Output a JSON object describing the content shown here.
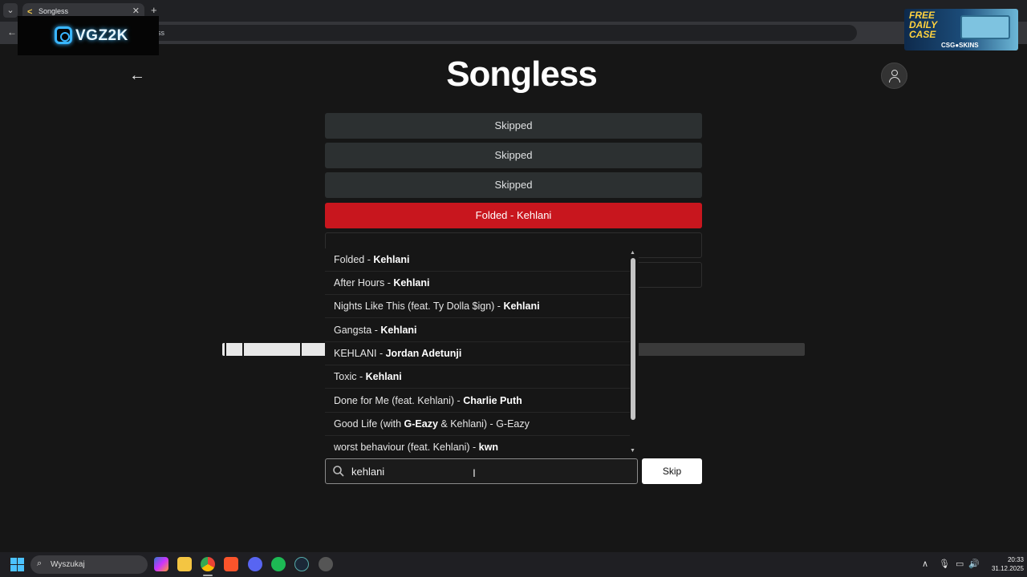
{
  "browser": {
    "tab_title": "Songless",
    "tab_favicon": "<",
    "url_fragment": "ss"
  },
  "overlay": {
    "streamer_name": "VGZ2K",
    "ad_headline": "FREE DAILY CASE",
    "ad_brand": "CSG●SKINS"
  },
  "page": {
    "logo": "Songless",
    "guesses": [
      {
        "label": "Skipped",
        "status": "skipped"
      },
      {
        "label": "Skipped",
        "status": "skipped"
      },
      {
        "label": "Skipped",
        "status": "skipped"
      },
      {
        "label": "Folded - Kehlani",
        "status": "answer"
      }
    ],
    "progress_fraction": 0.18
  },
  "dropdown": {
    "items": [
      {
        "title": "Folded",
        "sep": " - ",
        "artist": "Kehlani"
      },
      {
        "title": "After Hours",
        "sep": " - ",
        "artist": "Kehlani"
      },
      {
        "title": "Nights Like This (feat. Ty Dolla $ign)",
        "sep": " - ",
        "artist": "Kehlani"
      },
      {
        "title": "Gangsta",
        "sep": " - ",
        "artist": "Kehlani"
      },
      {
        "title": "KEHLANI",
        "sep": " - ",
        "artist": "Jordan Adetunji"
      },
      {
        "title": "Toxic",
        "sep": " - ",
        "artist": "Kehlani"
      },
      {
        "title": "Done for Me (feat. Kehlani)",
        "sep": " - ",
        "artist": "Charlie Puth"
      },
      {
        "title_pre": "Good Life (with ",
        "title_bold": "G-Eazy",
        "title_post": " & Kehlani) - G-Eazy"
      },
      {
        "title": "worst behaviour (feat. Kehlani)",
        "sep": " - ",
        "artist": "kwn"
      }
    ]
  },
  "search": {
    "value": "kehlani",
    "skip_label": "Skip"
  },
  "taskbar": {
    "search_label": "Wyszukaj",
    "time": "20:33",
    "date": "31.12.2025",
    "apps": [
      "copilot-icon",
      "file-explorer-icon",
      "chrome-icon",
      "brave-icon",
      "discord-icon",
      "spotify-icon",
      "steam-icon",
      "settings-icon"
    ]
  }
}
